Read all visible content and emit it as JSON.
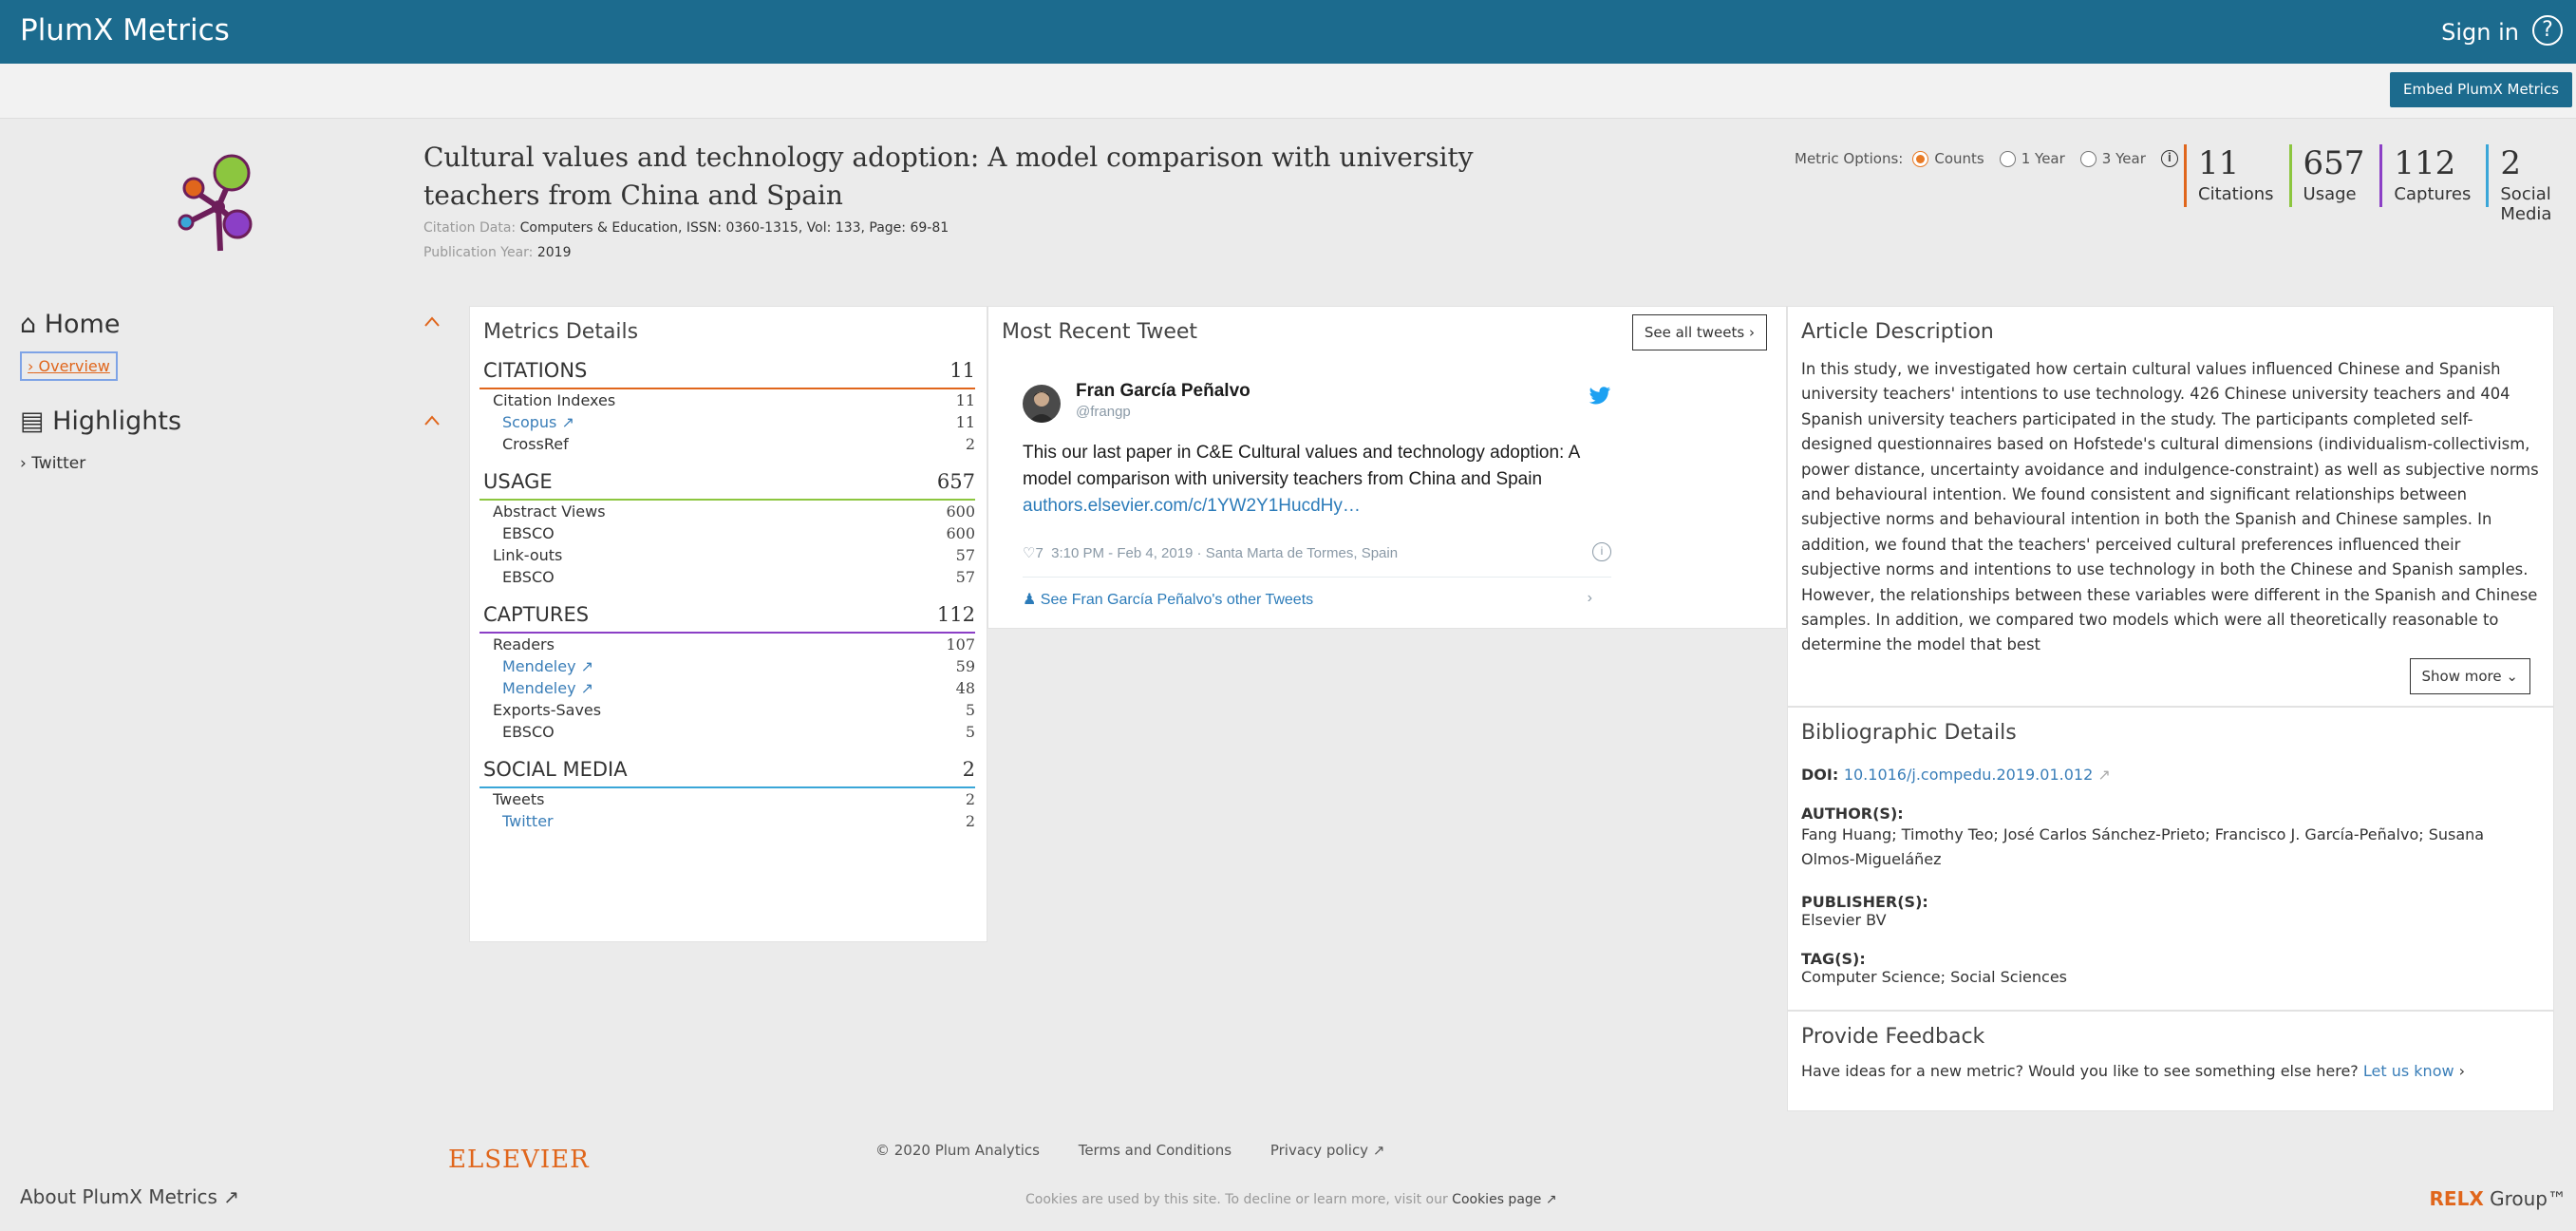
{
  "topbar": {
    "brand": "PlumX Metrics",
    "signin": "Sign in",
    "help": "?"
  },
  "subbar": {
    "embed": "Embed PlumX Metrics"
  },
  "article": {
    "title": "Cultural values and technology adoption: A model comparison with university teachers from China and Spain",
    "citation_label": "Citation Data: ",
    "citation_value": "Computers & Education, ISSN: 0360-1315, Vol: 133, Page: 69-81",
    "pubyear_label": "Publication Year: ",
    "pubyear_value": "2019"
  },
  "metric_options": {
    "label": "Metric Options:",
    "options": [
      "Counts",
      "1 Year",
      "3 Year"
    ],
    "selected": "Counts"
  },
  "summary": [
    {
      "num": "11",
      "label": "Citations",
      "color": "#e0661c"
    },
    {
      "num": "657",
      "label": "Usage",
      "color": "#8cc63f"
    },
    {
      "num": "112",
      "label": "Captures",
      "color": "#8b3fc6"
    },
    {
      "num": "2",
      "label": "Social Media",
      "color": "#3aa6d8"
    }
  ],
  "nav": {
    "home": "Home",
    "overview": "Overview",
    "highlights": "Highlights",
    "twitter": "Twitter"
  },
  "metrics": {
    "title": "Metrics Details",
    "citations": {
      "label": "CITATIONS",
      "count": "11",
      "color": "#e0661c",
      "rows": [
        [
          "Citation Indexes",
          "11",
          "main"
        ],
        [
          "Scopus ↗",
          "11",
          "link"
        ],
        [
          "CrossRef",
          "2",
          "sub"
        ]
      ]
    },
    "usage": {
      "label": "USAGE",
      "count": "657",
      "color": "#8cc63f",
      "rows": [
        [
          "Abstract Views",
          "600",
          "main"
        ],
        [
          "EBSCO",
          "600",
          "sub"
        ],
        [
          "Link-outs",
          "57",
          "main"
        ],
        [
          "EBSCO",
          "57",
          "sub"
        ]
      ]
    },
    "captures": {
      "label": "CAPTURES",
      "count": "112",
      "color": "#8b3fc6",
      "rows": [
        [
          "Readers",
          "107",
          "main"
        ],
        [
          "Mendeley ↗",
          "59",
          "link"
        ],
        [
          "Mendeley ↗",
          "48",
          "link"
        ],
        [
          "Exports-Saves",
          "5",
          "main"
        ],
        [
          "EBSCO",
          "5",
          "sub"
        ]
      ]
    },
    "social": {
      "label": "SOCIAL MEDIA",
      "count": "2",
      "color": "#3aa6d8",
      "rows": [
        [
          "Tweets",
          "2",
          "main"
        ],
        [
          "Twitter",
          "2",
          "link"
        ]
      ]
    }
  },
  "tweet_panel": {
    "title": "Most Recent Tweet",
    "see_all": "See all tweets",
    "name": "Fran García Peñalvo",
    "handle": "@frangp",
    "text": "This our last paper in C&E Cultural values and technology adoption: A model comparison with university teachers from China and Spain ",
    "link": "authors.elsevier.com/c/1YW2Y1HucdHy…",
    "likes": "7",
    "meta": "3:10 PM - Feb 4, 2019 · Santa Marta de Tormes, Spain",
    "other": "See Fran García Peñalvo's other Tweets"
  },
  "description": {
    "title": "Article Description",
    "text": "In this study, we investigated how certain cultural values influenced Chinese and Spanish university teachers' intentions to use technology. 426 Chinese university teachers and 404 Spanish university teachers participated in the study. The participants completed self-designed questionnaires based on Hofstede's cultural dimensions (individualism-collectivism, power distance, uncertainty avoidance and indulgence-constraint) as well as subjective norms and behavioural intention. We found consistent and significant relationships between subjective norms and behavioural intention in both the Spanish and Chinese samples. In addition, we found that the teachers' perceived cultural preferences influenced their subjective norms and intentions to use technology in both the Chinese and Spanish samples. However, the relationships between these variables were different in the Spanish and Chinese samples. In addition, we compared two models which were all theoretically reasonable to determine the model that best",
    "show_more": "Show more"
  },
  "biblio": {
    "title": "Bibliographic Details",
    "doi_label": "DOI: ",
    "doi": "10.1016/j.compedu.2019.01.012",
    "authors_label": "AUTHOR(S):",
    "authors": "Fang Huang; Timothy Teo; José Carlos Sánchez-Prieto; Francisco J. García-Peñalvo; Susana Olmos-Migueláñez",
    "publisher_label": "PUBLISHER(S):",
    "publisher": "Elsevier BV",
    "tags_label": "TAG(S):",
    "tags": "Computer Science; Social Sciences"
  },
  "feedback": {
    "title": "Provide Feedback",
    "text": "Have ideas for a new metric? Would you like to see something else here? ",
    "link": "Let us know"
  },
  "footer": {
    "elsevier": "ELSEVIER",
    "copyright": "© 2020 Plum Analytics",
    "terms": "Terms and Conditions",
    "privacy": "Privacy policy ↗",
    "cookie_pre": "Cookies are used by this site. To decline or learn more, visit our ",
    "cookie_link": "Cookies page ↗",
    "about": "About PlumX Metrics ↗",
    "relx": "RELX",
    "relx_group": " Group™"
  }
}
